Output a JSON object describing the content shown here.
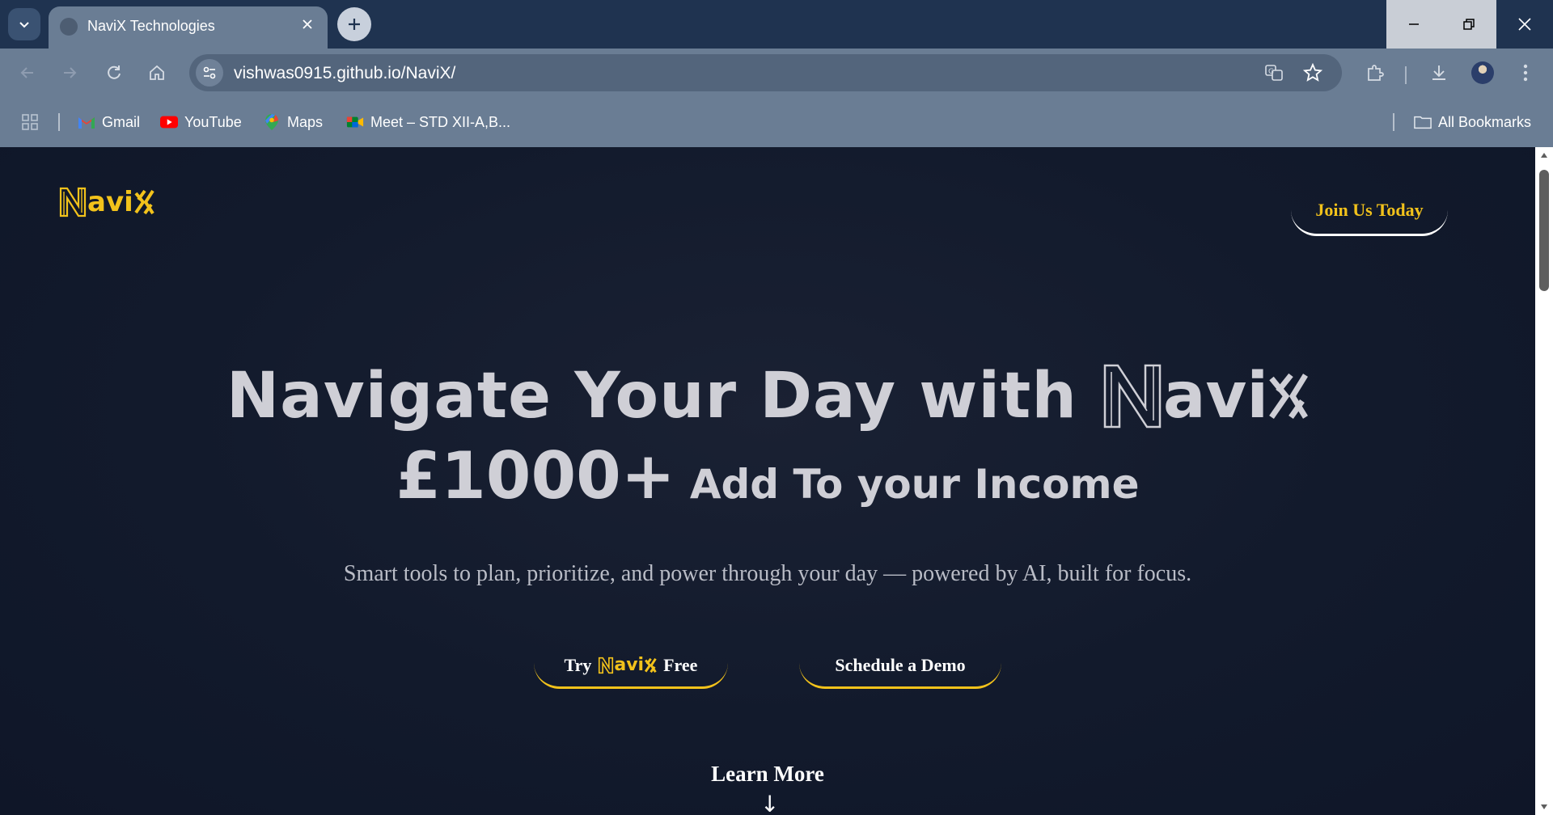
{
  "browser": {
    "tab_title": "NaviX Technologies",
    "url": "vishwas0915.github.io/NaviX/",
    "bookmarks": [
      {
        "label": "Gmail",
        "icon": "gmail-icon"
      },
      {
        "label": "YouTube",
        "icon": "youtube-icon"
      },
      {
        "label": "Maps",
        "icon": "maps-icon"
      },
      {
        "label": "Meet – STD XII-A,B...",
        "icon": "meet-icon"
      }
    ],
    "all_bookmarks": "All Bookmarks"
  },
  "site": {
    "logo": "NaviX",
    "nav_cta": "Join Us Today",
    "hero": {
      "line1": "Navigate Your Day with",
      "brand": "NaviX",
      "amount": "£1000+",
      "subline": "Add To your Income",
      "tagline": "Smart tools to plan, prioritize, and power through your day — powered by AI, built for focus."
    },
    "cta_try_prefix": "Try",
    "cta_try_brand": "NaviX",
    "cta_try_suffix": "Free",
    "cta_demo": "Schedule a Demo",
    "learn_more": "Learn More",
    "learn_arrow": "↓"
  },
  "colors": {
    "brand_yellow": "#f2c21b",
    "page_bg": "#0f1628",
    "hero_text": "#cfcfd6"
  }
}
